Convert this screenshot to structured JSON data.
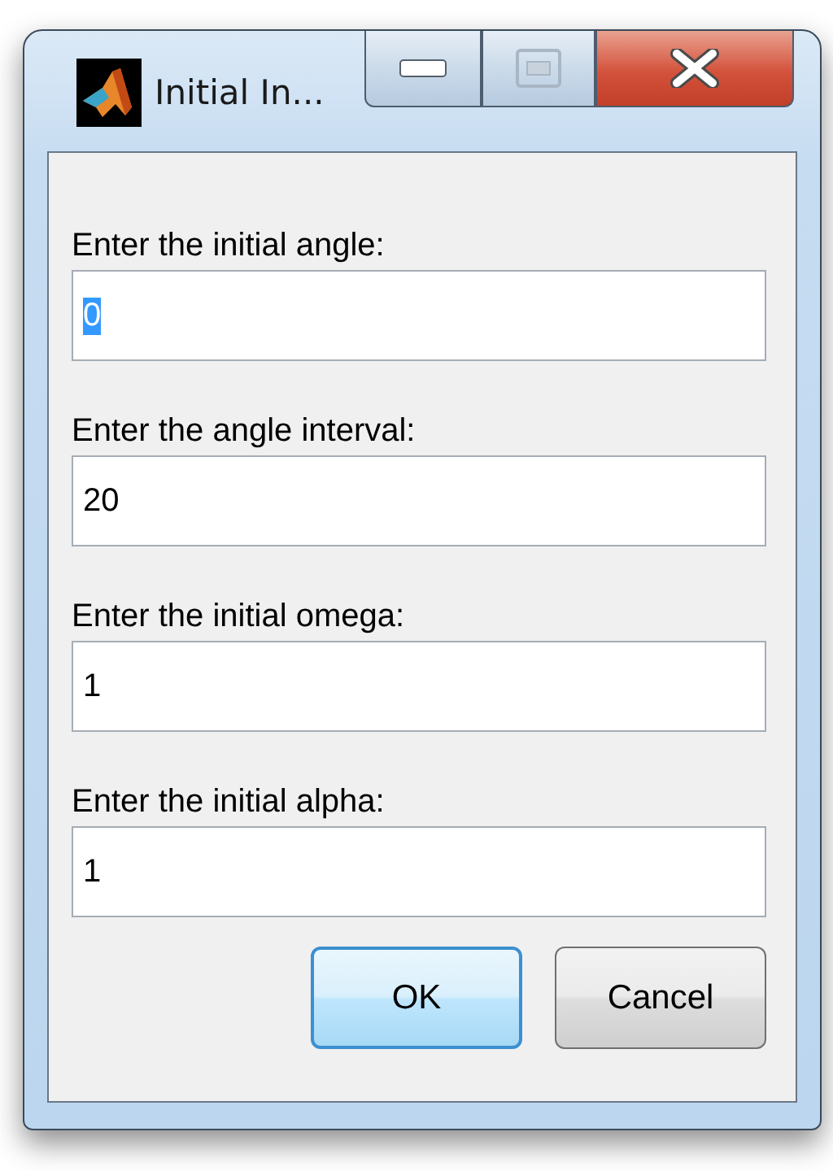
{
  "window": {
    "title": "Initial In..."
  },
  "fields": [
    {
      "label": "Enter the initial angle:",
      "value": "0",
      "text_selected": true
    },
    {
      "label": "Enter the angle interval:",
      "value": "20",
      "text_selected": false
    },
    {
      "label": "Enter the initial omega:",
      "value": "1",
      "text_selected": false
    },
    {
      "label": "Enter the initial alpha:",
      "value": "1",
      "text_selected": false
    }
  ],
  "buttons": [
    {
      "label": "OK",
      "default": true
    },
    {
      "label": "Cancel",
      "default": false
    }
  ]
}
